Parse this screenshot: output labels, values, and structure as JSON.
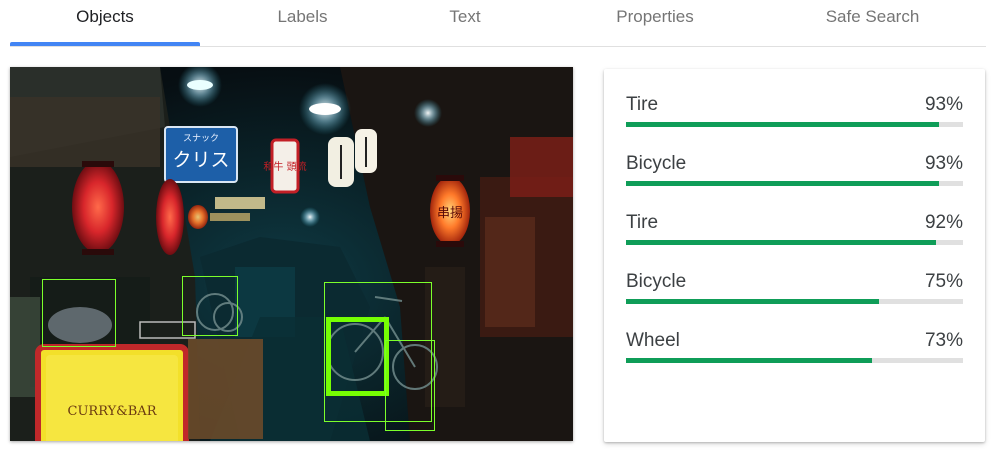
{
  "tabs": [
    {
      "label": "Objects",
      "active": true
    },
    {
      "label": "Labels",
      "active": false
    },
    {
      "label": "Text",
      "active": false
    },
    {
      "label": "Properties",
      "active": false
    },
    {
      "label": "Safe Search",
      "active": false
    }
  ],
  "image": {
    "signs": {
      "snack_small": "スナック",
      "snack_big": "クリス",
      "red_sign": "和牛 頭流",
      "lantern_right": "串揚",
      "shop_sign": "CURRY&BAR"
    },
    "detections": [
      {
        "label": "Tire",
        "selected": false
      },
      {
        "label": "Bicycle",
        "selected": false
      },
      {
        "label": "Tire",
        "selected": true
      },
      {
        "label": "Bicycle",
        "selected": false
      },
      {
        "label": "Wheel",
        "selected": false
      },
      {
        "label": "Tire",
        "selected": false
      },
      {
        "label": "Bicycle",
        "selected": false
      }
    ]
  },
  "results": [
    {
      "name": "Tire",
      "percent": "93%",
      "score": 0.93
    },
    {
      "name": "Bicycle",
      "percent": "93%",
      "score": 0.93
    },
    {
      "name": "Tire",
      "percent": "92%",
      "score": 0.92
    },
    {
      "name": "Bicycle",
      "percent": "75%",
      "score": 0.75
    },
    {
      "name": "Wheel",
      "percent": "73%",
      "score": 0.73
    }
  ],
  "colors": {
    "tab_indicator": "#4285f4",
    "score_bar": "#0f9d58",
    "bbox": "#76ff03"
  }
}
